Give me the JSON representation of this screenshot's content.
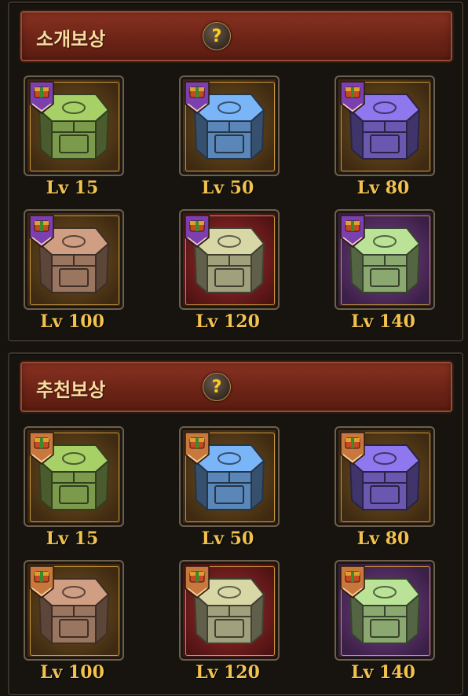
{
  "sections": [
    {
      "title": "소개보상",
      "help": "?",
      "badge": "purple",
      "items": [
        {
          "level": "Lv 15",
          "chest": "green-chest",
          "bg": "gold"
        },
        {
          "level": "Lv 50",
          "chest": "blue-chest",
          "bg": "gold"
        },
        {
          "level": "Lv 80",
          "chest": "purple-chest",
          "bg": "gold"
        },
        {
          "level": "Lv 100",
          "chest": "brown-chest",
          "bg": "gold"
        },
        {
          "level": "Lv 120",
          "chest": "silver-chest",
          "bg": "red"
        },
        {
          "level": "Lv 140",
          "chest": "jade-chest",
          "bg": "purple"
        }
      ]
    },
    {
      "title": "추천보상",
      "help": "?",
      "badge": "orange",
      "items": [
        {
          "level": "Lv 15",
          "chest": "green-chest",
          "bg": "gold"
        },
        {
          "level": "Lv 50",
          "chest": "blue-chest",
          "bg": "gold"
        },
        {
          "level": "Lv 80",
          "chest": "purple-chest",
          "bg": "gold"
        },
        {
          "level": "Lv 100",
          "chest": "brown-chest",
          "bg": "gold"
        },
        {
          "level": "Lv 120",
          "chest": "silver-chest",
          "bg": "red"
        },
        {
          "level": "Lv 140",
          "chest": "jade-chest",
          "bg": "purple"
        }
      ]
    }
  ],
  "colors": {
    "header": "#7a2a1b",
    "level_text": "#f2c14e",
    "badge_purple": "#7b3fb0",
    "badge_orange": "#c8783c"
  }
}
